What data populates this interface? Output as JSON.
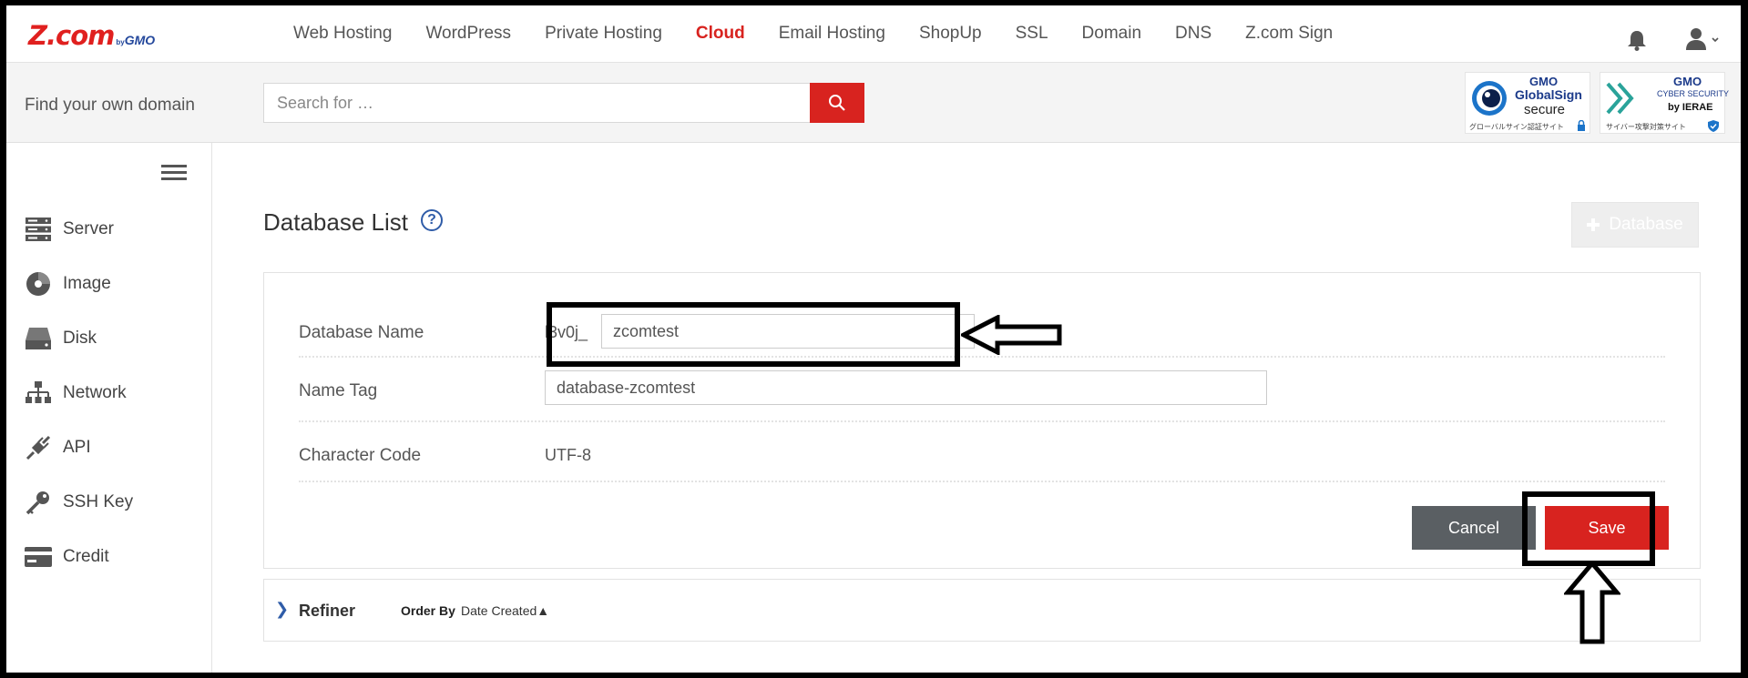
{
  "logo": {
    "main": "Z.com",
    "by": "by",
    "gmo": "GMO"
  },
  "nav": [
    {
      "label": "Web Hosting",
      "active": false
    },
    {
      "label": "WordPress",
      "active": false
    },
    {
      "label": "Private Hosting",
      "active": false
    },
    {
      "label": "Cloud",
      "active": true
    },
    {
      "label": "Email Hosting",
      "active": false
    },
    {
      "label": "ShopUp",
      "active": false
    },
    {
      "label": "SSL",
      "active": false
    },
    {
      "label": "Domain",
      "active": false
    },
    {
      "label": "DNS",
      "active": false
    },
    {
      "label": "Z.com Sign",
      "active": false
    }
  ],
  "header_icons": {
    "notification": "bell-icon",
    "account": "user-icon"
  },
  "domain_search": {
    "label": "Find your own domain",
    "placeholder": "Search for …",
    "button_icon": "search-icon"
  },
  "badges": {
    "globalsign": {
      "brand": "GMO",
      "name": "GlobalSign",
      "secure": "secure",
      "caption": "グローバルサイン認証サイト"
    },
    "cybersecurity": {
      "brand": "GMO",
      "line1": "CYBER SECURITY",
      "line2": "by IERAE",
      "caption": "サイバー攻撃対策サイト"
    }
  },
  "sidebar": {
    "items": [
      {
        "label": "Server",
        "icon": "server-icon"
      },
      {
        "label": "Image",
        "icon": "image-disc-icon"
      },
      {
        "label": "Disk",
        "icon": "disk-icon"
      },
      {
        "label": "Network",
        "icon": "network-icon"
      },
      {
        "label": "API",
        "icon": "api-plug-icon"
      },
      {
        "label": "SSH Key",
        "icon": "key-icon"
      },
      {
        "label": "Credit",
        "icon": "credit-card-icon"
      }
    ]
  },
  "main": {
    "title": "Database List",
    "help": "?",
    "add_button": "Database",
    "form": {
      "db_name_label": "Database Name",
      "db_name_prefix": "l3v0j_",
      "db_name_value": "zcomtest",
      "name_tag_label": "Name Tag",
      "name_tag_value": "database-zcomtest",
      "charset_label": "Character Code",
      "charset_value": "UTF-8"
    },
    "cancel_label": "Cancel",
    "save_label": "Save"
  },
  "refiner": {
    "chevron": "❯",
    "label": "Refiner",
    "order_by_label": "Order By",
    "order_by_value": "Date Created▲"
  },
  "colors": {
    "brand_red": "#d8231f",
    "brand_blue": "#24489c",
    "cancel_gray": "#5a5f63"
  }
}
